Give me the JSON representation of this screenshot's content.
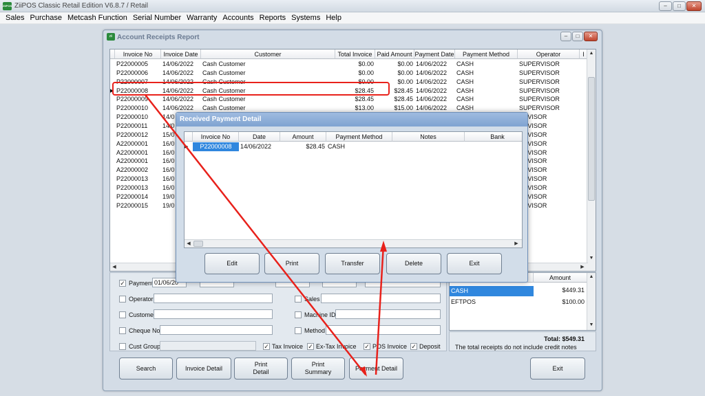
{
  "app": {
    "title": "ZiiPOS Classic Retail Edition V6.8.7 / Retail",
    "logo": "ZiiPOS"
  },
  "menu": [
    "Sales",
    "Purchase",
    "Metcash Function",
    "Serial Number",
    "Warranty",
    "Accounts",
    "Reports",
    "Systems",
    "Help"
  ],
  "report_window": {
    "title": "Account Receipts Report"
  },
  "receipts_table": {
    "columns": [
      "Invoice No",
      "Invoice Date",
      "Customer",
      "Total Invoice",
      "Paid Amount",
      "Payment Date",
      "Payment Method",
      "Operator"
    ],
    "rows": [
      [
        "P22000005",
        "14/06/2022",
        "Cash Customer",
        "$0.00",
        "$0.00",
        "14/06/2022",
        "CASH",
        "SUPERVISOR"
      ],
      [
        "P22000006",
        "14/06/2022",
        "Cash Customer",
        "$0.00",
        "$0.00",
        "14/06/2022",
        "CASH",
        "SUPERVISOR"
      ],
      [
        "P22000007",
        "14/06/2022",
        "Cash Customer",
        "$0.00",
        "$0.00",
        "14/06/2022",
        "CASH",
        "SUPERVISOR"
      ],
      [
        "P22000008",
        "14/06/2022",
        "Cash Customer",
        "$28.45",
        "$28.45",
        "14/06/2022",
        "CASH",
        "SUPERVISOR"
      ],
      [
        "P22000009",
        "14/06/2022",
        "Cash Customer",
        "$28.45",
        "$28.45",
        "14/06/2022",
        "CASH",
        "SUPERVISOR"
      ],
      [
        "P22000010",
        "14/06/2022",
        "Cash Customer",
        "$13.00",
        "$15.00",
        "14/06/2022",
        "CASH",
        "SUPERVISOR"
      ],
      [
        "P22000010",
        "14/0",
        "",
        "",
        "",
        "",
        "",
        "ERVISOR"
      ],
      [
        "P22000011",
        "14/0",
        "",
        "",
        "",
        "",
        "",
        "ERVISOR"
      ],
      [
        "P22000012",
        "15/0",
        "",
        "",
        "",
        "",
        "",
        "ERVISOR"
      ],
      [
        "A22000001",
        "16/0",
        "",
        "",
        "",
        "",
        "",
        "ERVISOR"
      ],
      [
        "A22000001",
        "16/0",
        "",
        "",
        "",
        "",
        "",
        "ERVISOR"
      ],
      [
        "A22000001",
        "16/0",
        "",
        "",
        "",
        "",
        "",
        "ERVISOR"
      ],
      [
        "A22000002",
        "16/0",
        "",
        "",
        "",
        "",
        "",
        "ERVISOR"
      ],
      [
        "P22000013",
        "16/0",
        "",
        "",
        "",
        "",
        "",
        "ERVISOR"
      ],
      [
        "P22000013",
        "16/0",
        "",
        "",
        "",
        "",
        "",
        "ERVISOR"
      ],
      [
        "P22000014",
        "19/0",
        "",
        "",
        "",
        "",
        "",
        "ERVISOR"
      ],
      [
        "P22000015",
        "19/0",
        "",
        "",
        "",
        "",
        "",
        "ERVISOR"
      ]
    ]
  },
  "filters": {
    "payment_label": "Payment",
    "payment_from": "01/06/20",
    "operator_label": "Operator",
    "sales_label": "Sales",
    "customer_label": "Customer",
    "machine_label": "Machine ID",
    "cheque_label": "Cheque No",
    "method_label": "Method",
    "cust_group_label": "Cust Group",
    "tax_invoice": "Tax Invoice",
    "ex_tax_invoice": "Ex-Tax Invoice",
    "pos_invoice": "POS Invoice",
    "deposit": "Deposit"
  },
  "summary": {
    "column": "Amount",
    "rows": [
      [
        "CASH",
        "$449.31"
      ],
      [
        "EFTPOS",
        "$100.00"
      ]
    ],
    "total": "Total: $549.31",
    "note": "The total receipts do not include credit notes"
  },
  "buttons": {
    "search": "Search",
    "invoice_detail": "Invoice Detail",
    "print_detail": "Print\nDetail",
    "print_summary": "Print\nSummary",
    "payment_detail": "Payment Detail",
    "exit": "Exit"
  },
  "dialog": {
    "title": "Received Payment Detail",
    "columns": [
      "Invoice No",
      "Date",
      "Amount",
      "Payment Method",
      "Notes",
      "Bank"
    ],
    "rows": [
      [
        "P22000008",
        "14/06/2022",
        "$28.45",
        "CASH",
        "",
        ""
      ]
    ],
    "buttons": {
      "edit": "Edit",
      "print": "Print",
      "transfer": "Transfer",
      "delete": "Delete",
      "exit": "Exit"
    }
  },
  "accent": {
    "highlight": "#e8211b",
    "selection": "#3087de"
  }
}
